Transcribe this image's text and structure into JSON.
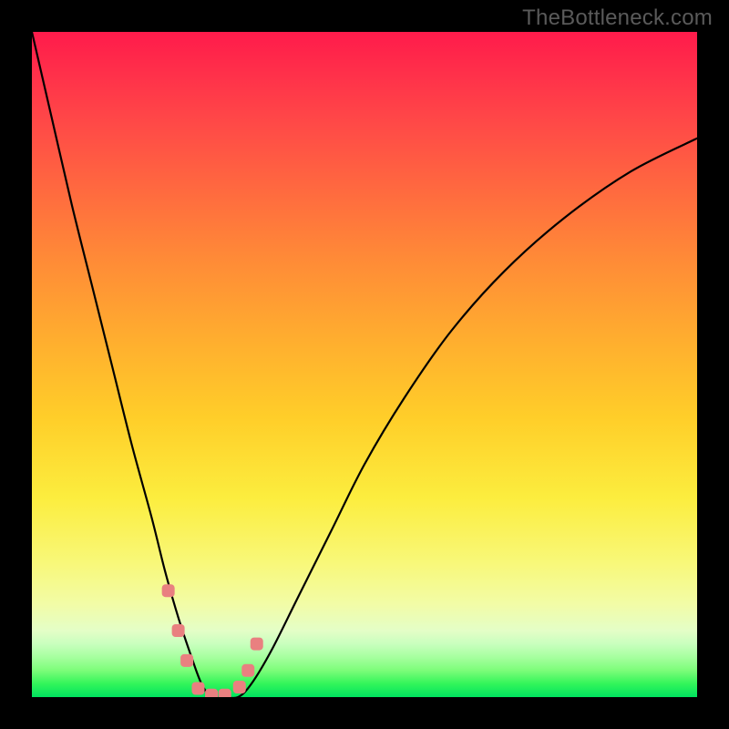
{
  "watermark": "TheBottleneck.com",
  "chart_data": {
    "type": "line",
    "title": "",
    "xlabel": "",
    "ylabel": "",
    "xlim": [
      0,
      100
    ],
    "ylim": [
      0,
      100
    ],
    "series": [
      {
        "name": "curve",
        "x": [
          0,
          3,
          6,
          9,
          12,
          15,
          18,
          20,
          22,
          24,
          25.5,
          27,
          29,
          31,
          33,
          36,
          40,
          45,
          50,
          56,
          63,
          71,
          80,
          90,
          100
        ],
        "values": [
          100,
          87,
          74,
          62,
          50,
          38,
          27,
          19,
          12,
          6,
          2,
          0,
          0,
          0,
          2,
          7,
          15,
          25,
          35,
          45,
          55,
          64,
          72,
          79,
          84
        ]
      }
    ],
    "markers": {
      "name": "highlight-points",
      "x": [
        20.5,
        22.0,
        23.3,
        25.0,
        27.0,
        29.0,
        31.2,
        32.5,
        33.8
      ],
      "values": [
        16.0,
        10.0,
        5.5,
        1.3,
        0.3,
        0.3,
        1.5,
        4.0,
        8.0
      ]
    },
    "gradient_stops": [
      {
        "pos": 0,
        "color": "#ff1b4b"
      },
      {
        "pos": 50,
        "color": "#ffb52d"
      },
      {
        "pos": 80,
        "color": "#f8f87a"
      },
      {
        "pos": 100,
        "color": "#00e35f"
      }
    ]
  }
}
